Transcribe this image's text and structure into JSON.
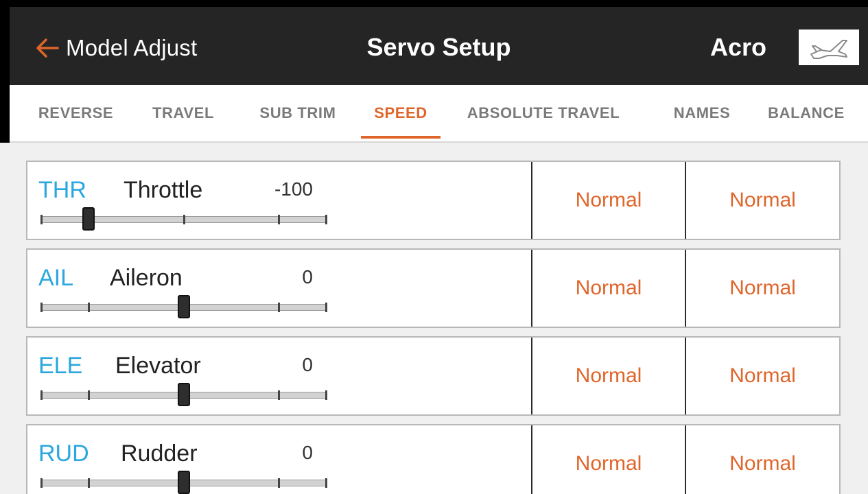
{
  "header": {
    "back_label": "Model Adjust",
    "title": "Servo Setup",
    "model_name": "Acro",
    "model_icon": "airplane-icon"
  },
  "tabs": [
    {
      "label": "REVERSE",
      "active": false
    },
    {
      "label": "TRAVEL",
      "active": false
    },
    {
      "label": "SUB TRIM",
      "active": false
    },
    {
      "label": "SPEED",
      "active": true
    },
    {
      "label": "ABSOLUTE TRAVEL",
      "active": false
    },
    {
      "label": "NAMES",
      "active": false
    },
    {
      "label": "BALANCE",
      "active": false
    }
  ],
  "channels": [
    {
      "abbr": "THR",
      "name": "Throttle",
      "value": "-100",
      "position": -100,
      "speed_a": "Normal",
      "speed_b": "Normal"
    },
    {
      "abbr": "AIL",
      "name": "Aileron",
      "value": "0",
      "position": 0,
      "speed_a": "Normal",
      "speed_b": "Normal"
    },
    {
      "abbr": "ELE",
      "name": "Elevator",
      "value": "0",
      "position": 0,
      "speed_a": "Normal",
      "speed_b": "Normal"
    },
    {
      "abbr": "RUD",
      "name": "Rudder",
      "value": "0",
      "position": 0,
      "speed_a": "Normal",
      "speed_b": "Normal"
    }
  ],
  "colors": {
    "accent": "#e0652a",
    "channel_abbr": "#2aa7de",
    "header_bg": "#252525"
  }
}
